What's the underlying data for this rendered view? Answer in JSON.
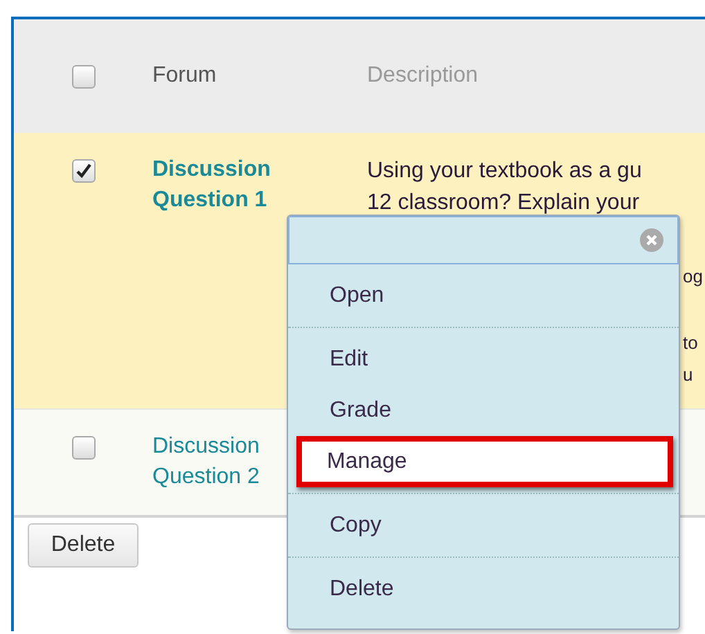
{
  "table": {
    "columns": [
      "Forum",
      "Description"
    ],
    "header_checked": false,
    "rows": [
      {
        "checked": true,
        "active": true,
        "forum": "Discussion Question 1",
        "description": {
          "lines": [
            "Using your textbook as a gu",
            "12 classroom? Explain your"
          ],
          "fragments": [
            "og",
            "to",
            "u"
          ]
        }
      },
      {
        "checked": false,
        "active": false,
        "forum": "Discussion Question 2"
      }
    ]
  },
  "delete_button": "Delete",
  "context_menu": {
    "groups": [
      [
        {
          "label": "Open",
          "selected": false
        }
      ],
      [
        {
          "label": "Edit",
          "selected": false
        },
        {
          "label": "Grade",
          "selected": false
        },
        {
          "label": "Manage",
          "selected": true
        }
      ],
      [
        {
          "label": "Copy",
          "selected": false
        }
      ],
      [
        {
          "label": "Delete",
          "selected": false
        }
      ]
    ]
  }
}
